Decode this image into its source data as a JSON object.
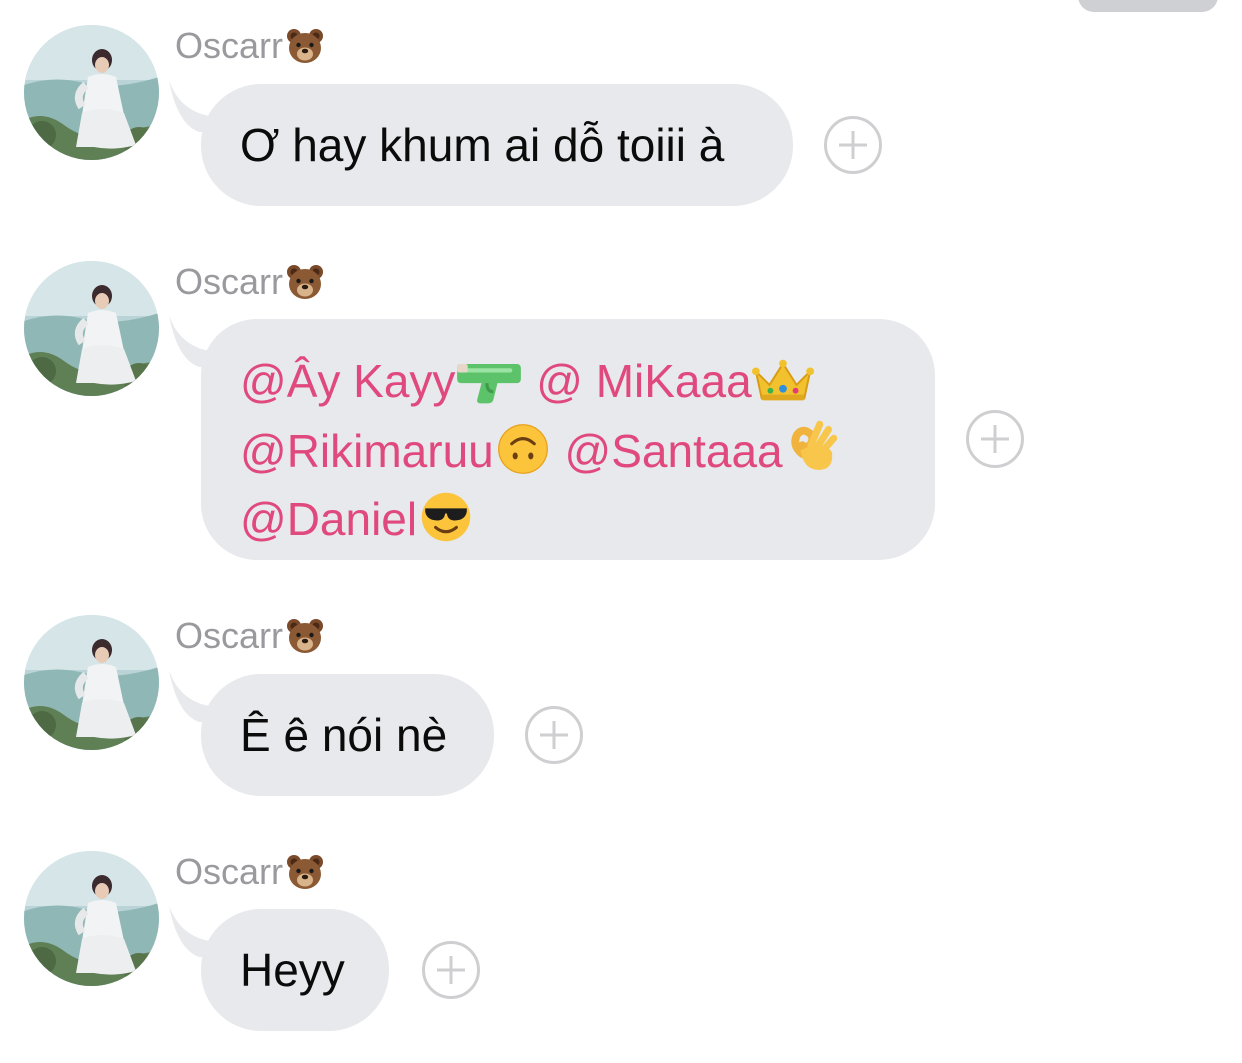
{
  "messages": [
    {
      "sender": "Oscarr",
      "sender_emoji": "bear-face-icon",
      "text": "Ơ hay khum ai dỗ toiii à"
    },
    {
      "sender": "Oscarr",
      "sender_emoji": "bear-face-icon",
      "lines": [
        [
          {
            "mention": "@Ây Kayy",
            "emoji": "water-pistol-icon"
          },
          {
            "mention": "@ MiKaaa",
            "emoji": "crown-icon"
          }
        ],
        [
          {
            "mention": "@Rikimaruu",
            "emoji": "upside-down-face-icon"
          },
          {
            "mention": "@Santaaa",
            "emoji": "ok-hand-icon"
          }
        ],
        [
          {
            "mention": "@Daniel",
            "emoji": "sunglasses-face-icon"
          }
        ]
      ]
    },
    {
      "sender": "Oscarr",
      "sender_emoji": "bear-face-icon",
      "text": "Ê ê nói nè"
    },
    {
      "sender": "Oscarr",
      "sender_emoji": "bear-face-icon",
      "text": "Heyy"
    }
  ],
  "colors": {
    "bubble": "#e8e9ec",
    "mention": "#e0497d",
    "sender": "#9a9a9e",
    "react_button": "#cfcfd2"
  }
}
